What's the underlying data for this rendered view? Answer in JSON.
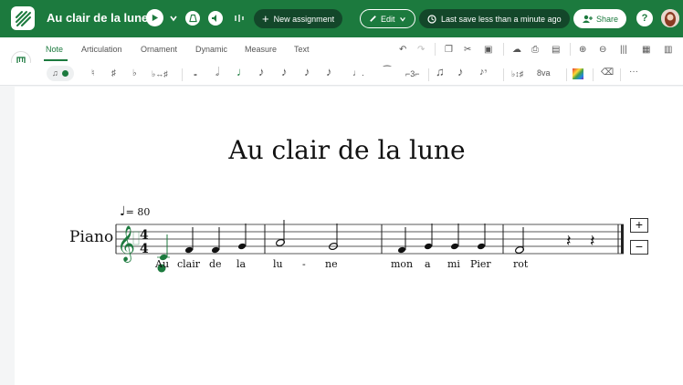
{
  "app": {
    "title": "Au clair de la lune",
    "new_assignment_label": "New assignment",
    "edit_label": "Edit",
    "save_status": "Last save less than a minute ago",
    "share_label": "Share"
  },
  "tabs": [
    "Note",
    "Articulation",
    "Ornament",
    "Dynamic",
    "Measure",
    "Text"
  ],
  "active_tab": "Note",
  "note_tools": {
    "natural": "♮",
    "sharp": "♯",
    "flat": "♭",
    "enharmonic": "♭↔♯",
    "octave": "8va",
    "more": "···"
  },
  "score": {
    "title": "Au clair de la lune",
    "instrument": "Piano",
    "tempo": "= 80",
    "time_signature": [
      "4",
      "4"
    ],
    "lyrics": [
      "Au",
      "clair",
      "de",
      "la",
      "lu",
      "-",
      "ne",
      "mon",
      "a",
      "mi",
      "Pier",
      "rot"
    ]
  },
  "zoom": {
    "plus": "+",
    "minus": "−"
  },
  "colors": {
    "brand": "#1c7a3e",
    "dark_pill": "#13472a"
  }
}
